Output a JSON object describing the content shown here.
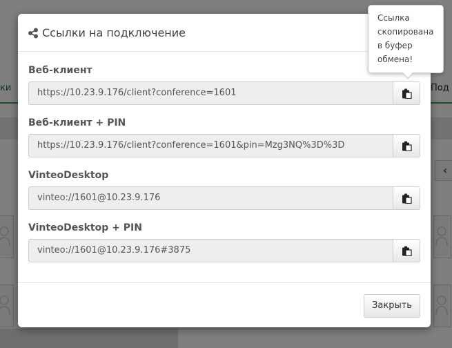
{
  "background": {
    "left_tab_fragment": "ки",
    "right_tab_fragment": "Под",
    "nav_glyph": "‹",
    "accent_color": "#3b9c52"
  },
  "modal": {
    "title": "Ссылки на подключение",
    "title_icon": "share-icon",
    "fields": [
      {
        "label": "Веб-клиент",
        "value": "https://10.23.9.176/client?conference=1601",
        "button_icon": "clipboard-icon"
      },
      {
        "label": "Веб-клиент + PIN",
        "value": "https://10.23.9.176/client?conference=1601&pin=Mzg3NQ%3D%3D",
        "button_icon": "clipboard-icon"
      },
      {
        "label": "VinteoDesktop",
        "value": "vinteo://1601@10.23.9.176",
        "button_icon": "clipboard-icon"
      },
      {
        "label": "VinteoDesktop + PIN",
        "value": "vinteo://1601@10.23.9.176#3875",
        "button_icon": "clipboard-icon"
      }
    ],
    "close_label": "Закрыть"
  },
  "tooltip": {
    "lines": [
      "Ссылка",
      "скопирована",
      "в буфер",
      "обмена!"
    ]
  }
}
